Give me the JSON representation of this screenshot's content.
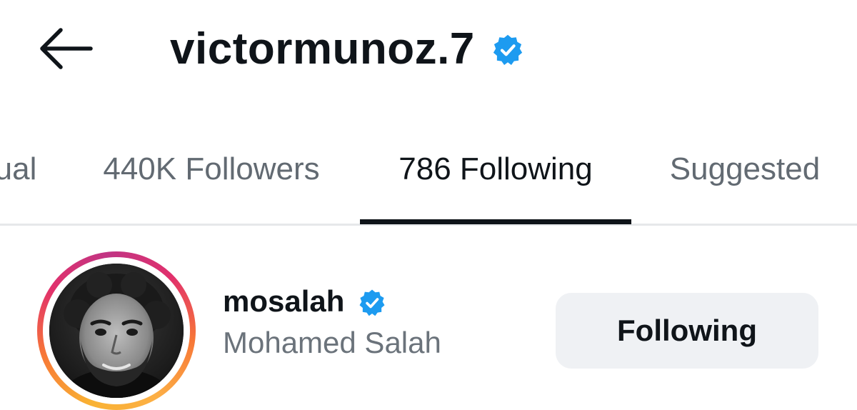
{
  "header": {
    "title": "victormunoz.7",
    "back_icon": "arrow-left-icon",
    "verified_icon": "verified-badge-icon"
  },
  "tabs": [
    {
      "label": "ual",
      "active": false
    },
    {
      "label": "440K Followers",
      "active": false
    },
    {
      "label": "786 Following",
      "active": true
    },
    {
      "label": "Suggested",
      "active": false
    }
  ],
  "list": {
    "items": [
      {
        "username": "mosalah",
        "full_name": "Mohamed Salah",
        "verified": true,
        "story_ring": true,
        "button_label": "Following"
      }
    ]
  },
  "colors": {
    "verified_blue": "#1d9bf0",
    "text_primary": "#0f1419",
    "text_secondary": "#6b737b",
    "button_bg": "#eff1f4",
    "tab_indicator": "#0f1419"
  }
}
